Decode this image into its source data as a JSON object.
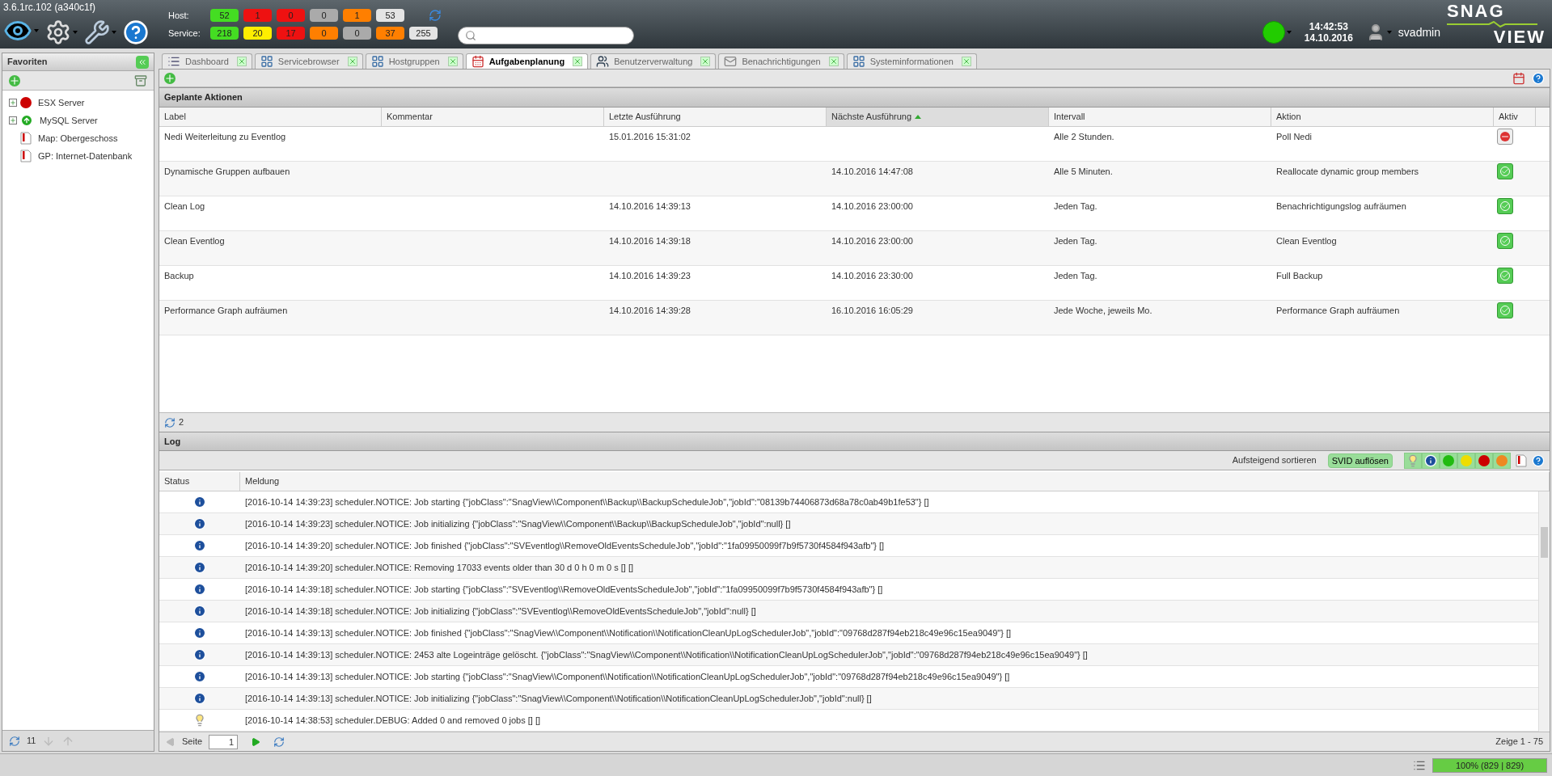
{
  "version": "3.6.1rc.102 (a340c1f)",
  "status_counts": [
    {
      "label": "Host:",
      "badges": [
        {
          "value": "52",
          "color": "#44dd22"
        },
        {
          "value": "1",
          "color": "#ee1111"
        },
        {
          "value": "0",
          "color": "#ee1111"
        },
        {
          "value": "0",
          "color": "#aaaaaa"
        },
        {
          "value": "1",
          "color": "#ff7f00"
        },
        {
          "value": "53",
          "color": "#e4e4e4"
        }
      ]
    },
    {
      "label": "Service:",
      "badges": [
        {
          "value": "218",
          "color": "#44dd22"
        },
        {
          "value": "20",
          "color": "#ffee00"
        },
        {
          "value": "17",
          "color": "#ee1111"
        },
        {
          "value": "0",
          "color": "#ff7f00"
        },
        {
          "value": "0",
          "color": "#aaaaaa"
        },
        {
          "value": "37",
          "color": "#ff7f00"
        },
        {
          "value": "255",
          "color": "#e4e4e4"
        }
      ]
    }
  ],
  "clock": {
    "time": "14:42:53",
    "date": "14.10.2016"
  },
  "user": "svadmin",
  "logo": [
    "SNAG",
    "VIEW"
  ],
  "sidebar": {
    "title": "Favoriten",
    "items": [
      {
        "kind": "host-down",
        "label": "ESX Server"
      },
      {
        "kind": "host-up",
        "label": "MySQL Server"
      },
      {
        "kind": "map",
        "label": "Map: Obergeschoss"
      },
      {
        "kind": "map",
        "label": "GP: Internet-Datenbank"
      }
    ],
    "count": "11"
  },
  "tabs": [
    {
      "kind": "dashboard",
      "label": "Dashboard",
      "selected": false
    },
    {
      "kind": "browser",
      "label": "Servicebrowser",
      "selected": false
    },
    {
      "kind": "browser",
      "label": "Hostgruppen",
      "selected": false
    },
    {
      "kind": "scheduler",
      "label": "Aufgabenplanung",
      "selected": true
    },
    {
      "kind": "users",
      "label": "Benutzerverwaltung",
      "selected": false
    },
    {
      "kind": "notifications",
      "label": "Benachrichtigungen",
      "selected": false
    },
    {
      "kind": "browser",
      "label": "Systeminformationen",
      "selected": false
    }
  ],
  "scheduled": {
    "title": "Geplante Aktionen",
    "columns": [
      {
        "label": "Label",
        "sorted": false
      },
      {
        "label": "Kommentar",
        "sorted": false
      },
      {
        "label": "Letzte Ausführung",
        "sorted": false
      },
      {
        "label": "Nächste Ausführung",
        "sorted": true
      },
      {
        "label": "Intervall",
        "sorted": false
      },
      {
        "label": "Aktion",
        "sorted": false
      },
      {
        "label": "Aktiv",
        "sorted": false
      }
    ],
    "rows": [
      {
        "cells": [
          "Nedi Weiterleitung zu Eventlog",
          "",
          "15.01.2016 15:31:02",
          "",
          "Alle 2 Stunden.",
          "Poll Nedi"
        ],
        "active": false
      },
      {
        "cells": [
          "Dynamische Gruppen aufbauen",
          "",
          "",
          "14.10.2016 14:47:08",
          "Alle 5 Minuten.",
          "Reallocate dynamic group members"
        ],
        "active": true
      },
      {
        "cells": [
          "Clean Log",
          "",
          "14.10.2016 14:39:13",
          "14.10.2016 23:00:00",
          "Jeden Tag.",
          "Benachrichtigungslog aufräumen"
        ],
        "active": true
      },
      {
        "cells": [
          "Clean Eventlog",
          "",
          "14.10.2016 14:39:18",
          "14.10.2016 23:00:00",
          "Jeden Tag.",
          "Clean Eventlog"
        ],
        "active": true
      },
      {
        "cells": [
          "Backup",
          "",
          "14.10.2016 14:39:23",
          "14.10.2016 23:30:00",
          "Jeden Tag.",
          "Full Backup"
        ],
        "active": true
      },
      {
        "cells": [
          "Performance Graph aufräumen",
          "",
          "14.10.2016 14:39:28",
          "16.10.2016 16:05:29",
          "Jede Woche, jeweils Mo.",
          "Performance Graph aufräumen"
        ],
        "active": true
      }
    ],
    "count": "2"
  },
  "log": {
    "title": "Log",
    "sort_label": "Aufsteigend sortieren",
    "svid_button": "SVID auflösen",
    "filters": [
      {
        "kind": "debug",
        "active": true
      },
      {
        "kind": "info",
        "active": true
      },
      {
        "kind": "green",
        "active": true
      },
      {
        "kind": "yellow",
        "active": true
      },
      {
        "kind": "red",
        "active": true
      },
      {
        "kind": "orange",
        "active": true
      }
    ],
    "columns": [
      "Status",
      "Meldung"
    ],
    "rows": [
      {
        "kind": "info",
        "message": "[2016-10-14 14:39:23] scheduler.NOTICE: Job starting {\"jobClass\":\"SnagView\\\\Component\\\\Backup\\\\BackupScheduleJob\",\"jobId\":\"08139b74406873d68a78c0ab49b1fe53\"} []"
      },
      {
        "kind": "info",
        "message": "[2016-10-14 14:39:23] scheduler.NOTICE: Job initializing {\"jobClass\":\"SnagView\\\\Component\\\\Backup\\\\BackupScheduleJob\",\"jobId\":null} []"
      },
      {
        "kind": "info",
        "message": "[2016-10-14 14:39:20] scheduler.NOTICE: Job finished {\"jobClass\":\"SVEventlog\\\\RemoveOldEventsScheduleJob\",\"jobId\":\"1fa09950099f7b9f5730f4584f943afb\"} []"
      },
      {
        "kind": "info",
        "message": "[2016-10-14 14:39:20] scheduler.NOTICE: Removing 17033 events older than 30 d 0 h 0 m 0 s [] []"
      },
      {
        "kind": "info",
        "message": "[2016-10-14 14:39:18] scheduler.NOTICE: Job starting {\"jobClass\":\"SVEventlog\\\\RemoveOldEventsScheduleJob\",\"jobId\":\"1fa09950099f7b9f5730f4584f943afb\"} []"
      },
      {
        "kind": "info",
        "message": "[2016-10-14 14:39:18] scheduler.NOTICE: Job initializing {\"jobClass\":\"SVEventlog\\\\RemoveOldEventsScheduleJob\",\"jobId\":null} []"
      },
      {
        "kind": "info",
        "message": "[2016-10-14 14:39:13] scheduler.NOTICE: Job finished {\"jobClass\":\"SnagView\\\\Component\\\\Notification\\\\NotificationCleanUpLogSchedulerJob\",\"jobId\":\"09768d287f94eb218c49e96c15ea9049\"} []"
      },
      {
        "kind": "info",
        "message": "[2016-10-14 14:39:13] scheduler.NOTICE: 2453 alte Logeinträge gelöscht. {\"jobClass\":\"SnagView\\\\Component\\\\Notification\\\\NotificationCleanUpLogSchedulerJob\",\"jobId\":\"09768d287f94eb218c49e96c15ea9049\"} []"
      },
      {
        "kind": "info",
        "message": "[2016-10-14 14:39:13] scheduler.NOTICE: Job starting {\"jobClass\":\"SnagView\\\\Component\\\\Notification\\\\NotificationCleanUpLogSchedulerJob\",\"jobId\":\"09768d287f94eb218c49e96c15ea9049\"} []"
      },
      {
        "kind": "info",
        "message": "[2016-10-14 14:39:13] scheduler.NOTICE: Job initializing {\"jobClass\":\"SnagView\\\\Component\\\\Notification\\\\NotificationCleanUpLogSchedulerJob\",\"jobId\":null} []"
      },
      {
        "kind": "debug",
        "message": "[2016-10-14 14:38:53] scheduler.DEBUG: Added 0 and removed 0 jobs [] []"
      }
    ]
  },
  "pager": {
    "page_label": "Seite",
    "page": "1",
    "summary": "Zeige 1 - 75"
  },
  "status_bar": {
    "text": "100% (829 | 829)",
    "level": 1
  }
}
